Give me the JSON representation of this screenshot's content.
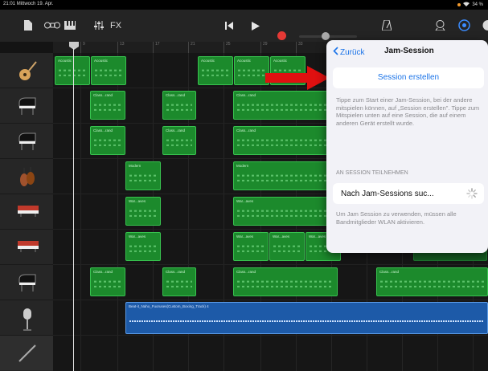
{
  "status_bar": {
    "time": "21:01",
    "date": "Mittwoch 19. Apr.",
    "battery": "34 %"
  },
  "toolbar": {
    "fx_label": "FX"
  },
  "ruler": {
    "marks": [
      "9",
      "13",
      "17",
      "21",
      "25",
      "29",
      "33"
    ]
  },
  "tracks": [
    {
      "instrument": "acoustic-guitar",
      "regions": [
        {
          "name": "Acoustic"
        },
        {
          "name": "Acoustic"
        },
        {
          "name": "Acoustic"
        },
        {
          "name": "Acoustic"
        },
        {
          "name": "Acoustic"
        }
      ]
    },
    {
      "instrument": "grand-piano",
      "regions": [
        {
          "name": "Class...rand"
        },
        {
          "name": "Class...rand"
        },
        {
          "name": "Class...rand"
        }
      ]
    },
    {
      "instrument": "grand-piano",
      "regions": [
        {
          "name": "Class...rand"
        },
        {
          "name": "Class...rand"
        },
        {
          "name": "Class...rand"
        }
      ]
    },
    {
      "instrument": "strings",
      "regions": [
        {
          "name": "Modern"
        },
        {
          "name": "Modern"
        }
      ]
    },
    {
      "instrument": "synth-keyboard",
      "regions": [
        {
          "name": "War...aves"
        },
        {
          "name": "War...aves"
        }
      ]
    },
    {
      "instrument": "synth-keyboard",
      "regions": [
        {
          "name": "War...aves"
        },
        {
          "name": "War...aves"
        },
        {
          "name": "War...aves"
        },
        {
          "name": "War...aves"
        }
      ]
    },
    {
      "instrument": "grand-piano",
      "regions": [
        {
          "name": "Class...rand"
        },
        {
          "name": "Class...rand"
        },
        {
          "name": "Class...rand"
        },
        {
          "name": "Class...rand"
        }
      ]
    },
    {
      "instrument": "microphone",
      "regions": [
        {
          "name": "Beat-it_Naho_Fuoruses(Custom_Boxing_Track) 4"
        }
      ]
    },
    {
      "instrument": "bass",
      "regions": []
    }
  ],
  "popover": {
    "back_label": "Zurück",
    "title": "Jam-Session",
    "create_button": "Session erstellen",
    "description": "Tippe zum Start einer Jam-Session, bei der andere mitspielen können, auf „Session erstellen\". Tippe zum Mitspielen unten auf eine Session, die auf einem anderen Gerät erstellt wurde.",
    "section_header": "AN SESSION TEILNEHMEN",
    "search_label": "Nach Jam-Sessions suc...",
    "footer_note": "Um Jam Session zu verwenden, müssen alle Bandmitglieder WLAN aktivieren."
  },
  "colors": {
    "midi_region": "#1c8a2c",
    "audio_region": "#1d5aa8",
    "accent": "#1a73e8",
    "record": "#e53935",
    "annotation_arrow": "#e01010"
  }
}
